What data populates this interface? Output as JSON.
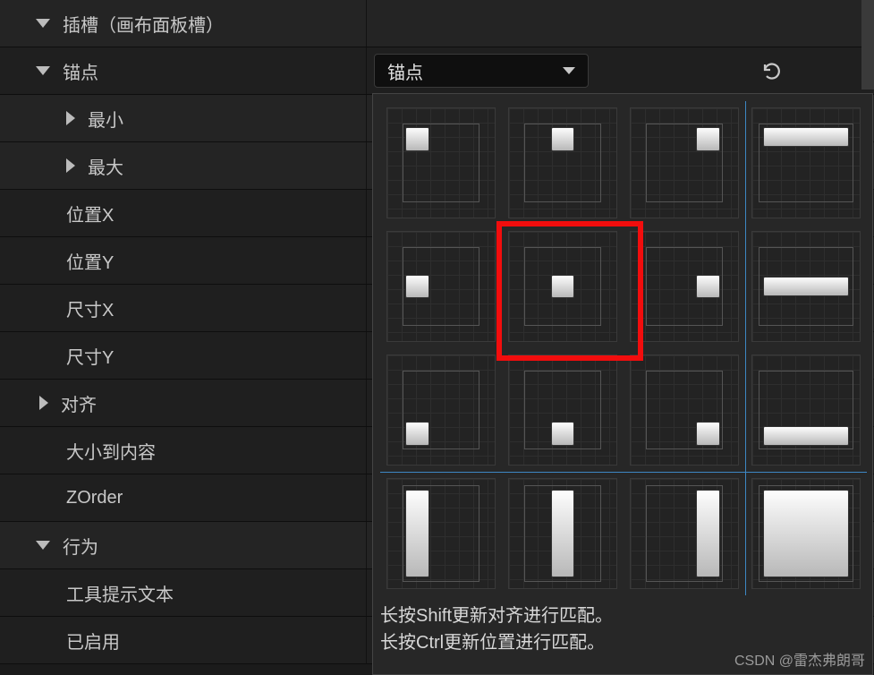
{
  "panel": {
    "slot_header": "插槽（画布面板槽）",
    "anchor": "锚点",
    "min": "最小",
    "max": "最大",
    "posx": "位置X",
    "posy": "位置Y",
    "sizex": "尺寸X",
    "sizey": "尺寸Y",
    "align": "对齐",
    "size_to_content": "大小到内容",
    "zorder": "ZOrder",
    "behavior": "行为",
    "tooltip_text": "工具提示文本",
    "enabled": "已启用"
  },
  "dropdown": {
    "anchor_label": "锚点"
  },
  "picker": {
    "hint1": "长按Shift更新对齐进行匹配。",
    "hint2": "长按Ctrl更新位置进行匹配。"
  },
  "watermark": "CSDN @雷杰弗朗哥"
}
